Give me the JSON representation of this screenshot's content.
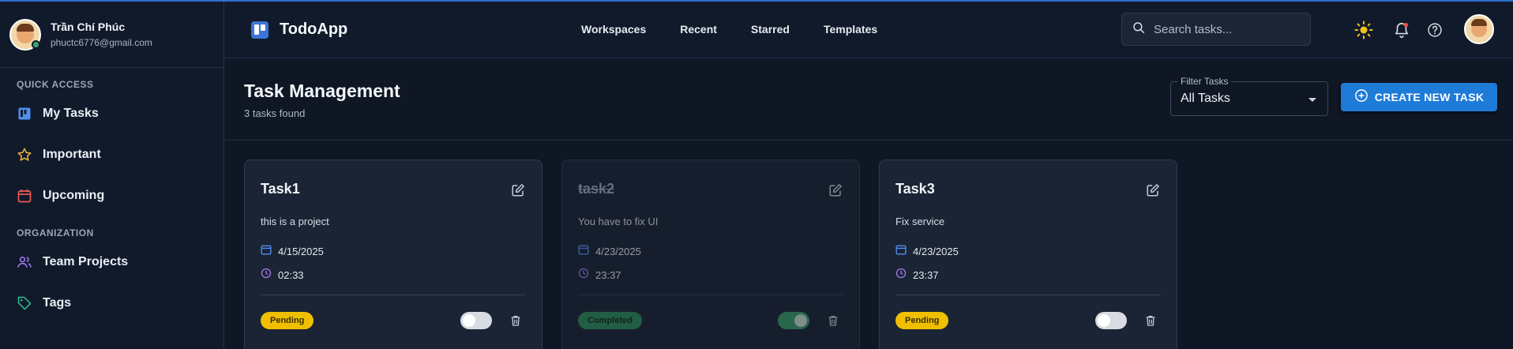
{
  "user": {
    "name": "Trần Chí Phúc",
    "email": "phuctc6776@gmail.com"
  },
  "sidebar": {
    "quick_access_title": "QUICK ACCESS",
    "quick_access": [
      {
        "label": "My Tasks",
        "icon": "kanban-icon"
      },
      {
        "label": "Important",
        "icon": "star-icon"
      },
      {
        "label": "Upcoming",
        "icon": "calendar-icon"
      }
    ],
    "organization_title": "ORGANIZATION",
    "organization": [
      {
        "label": "Team Projects",
        "icon": "people-icon"
      },
      {
        "label": "Tags",
        "icon": "tag-icon"
      }
    ]
  },
  "header": {
    "brand": "TodoApp",
    "nav": [
      "Workspaces",
      "Recent",
      "Starred",
      "Templates"
    ],
    "search_placeholder": "Search tasks..."
  },
  "page": {
    "title": "Task Management",
    "subtitle": "3 tasks found",
    "filter_label": "Filter Tasks",
    "filter_value": "All Tasks",
    "create_label": "CREATE NEW TASK"
  },
  "tasks": [
    {
      "title": "Task1",
      "description": "this is a project",
      "date": "4/15/2025",
      "time": "02:33",
      "status": "Pending",
      "completed": false
    },
    {
      "title": "task2",
      "description": "You have to fix UI",
      "date": "4/23/2025",
      "time": "23:37",
      "status": "Completed",
      "completed": true
    },
    {
      "title": "Task3",
      "description": "Fix service",
      "date": "4/23/2025",
      "time": "23:37",
      "status": "Pending",
      "completed": false
    }
  ],
  "colors": {
    "accent": "#1e7bd8",
    "pending": "#f0c000",
    "completed": "#2e8b57",
    "background": "#0f1624"
  }
}
